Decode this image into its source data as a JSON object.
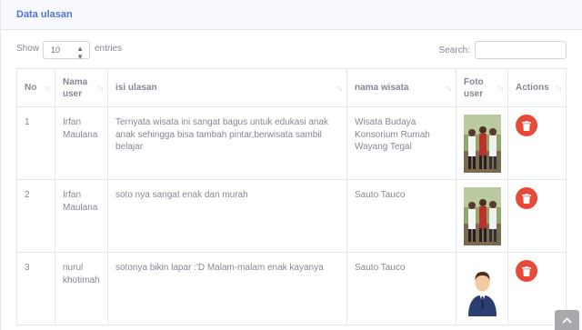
{
  "card": {
    "title": "Data ulasan"
  },
  "controls": {
    "show_label": "Show",
    "page_length": "10",
    "entries_label": "entries",
    "search_label": "Search:",
    "search_value": ""
  },
  "table": {
    "headers": {
      "no": "No",
      "nama_user": "Nama user",
      "isi_ulasan": "isi ulasan",
      "nama_wisata": "nama wisata",
      "foto_user": "Foto user",
      "actions": "Actions"
    },
    "rows": [
      {
        "no": "1",
        "nama_user": "Irfan Maulana",
        "isi_ulasan": "Ternyata wisata ini sangat bagus untuk edukasi anak anak sehingga bisa tambah pintar,berwisata sambil belajar",
        "nama_wisata": "Wisata Budaya Konsorium Rumah Wayang Tegal",
        "foto": "group-photo"
      },
      {
        "no": "2",
        "nama_user": "Irfan Maulana",
        "isi_ulasan": "soto nya sangat enak dan murah",
        "nama_wisata": "Sauto Tauco",
        "foto": "group-photo"
      },
      {
        "no": "3",
        "nama_user": "nurul khotimah",
        "isi_ulasan": "sotonya bikin lapar :'D Malam-malam enak kayanya",
        "nama_wisata": "Sauto Tauco",
        "foto": "default-avatar"
      }
    ]
  },
  "icons": {
    "delete": "trash-icon",
    "scroll_top": "chevron-up-icon",
    "sort": "sort-icon"
  },
  "colors": {
    "accent": "#4e73df",
    "danger": "#e74a3b",
    "text": "#858796"
  }
}
